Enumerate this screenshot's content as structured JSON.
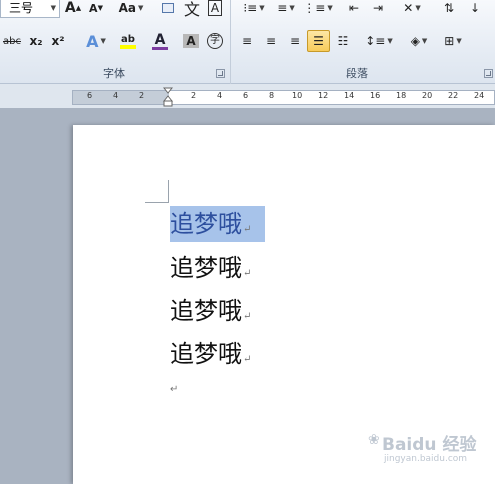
{
  "ribbon": {
    "font_group": {
      "label": "字体",
      "font_size_value": "三号",
      "grow_font_label": "A",
      "shrink_font_label": "A",
      "change_case_label": "Aa",
      "strikethrough_label": "abc",
      "subscript_label": "x₂",
      "superscript_label": "x²",
      "text_effect_label": "A",
      "highlight_label": "ab",
      "font_color_label": "A",
      "char_shading_label": "A",
      "enclose_char_label": "字",
      "phonetic_label": "文",
      "char_border_label": "A"
    },
    "paragraph_group": {
      "label": "段落"
    }
  },
  "ruler": {
    "numbers": [
      "6",
      "4",
      "2",
      "2",
      "4",
      "6",
      "8",
      "10",
      "12",
      "14",
      "16",
      "18",
      "20",
      "22",
      "24"
    ]
  },
  "document": {
    "lines": [
      "追梦哦",
      "追梦哦",
      "追梦哦",
      "追梦哦"
    ],
    "paragraph_mark": "↵"
  },
  "watermark": {
    "main": "Baidu 经验",
    "sub": "jingyan.baidu.com"
  },
  "colors": {
    "selection": "#a7c3ea",
    "selected_text": "#2d4f9e",
    "highlight_yellow": "#ffff00",
    "font_color_red": "#e03030",
    "active_button": "#f8cc5a"
  }
}
